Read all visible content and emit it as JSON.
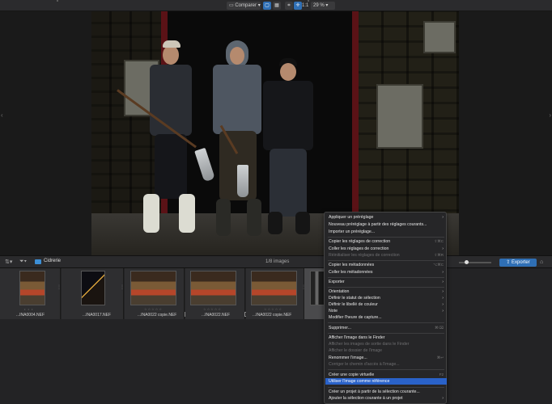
{
  "toolbar": {
    "compare_label": "Comparer",
    "ratio_label": "1:1",
    "zoom_value": "29 %"
  },
  "strip_bar": {
    "folder_name": "Cidrerie",
    "count": "1/8 images",
    "export_label": "Exporter"
  },
  "thumbnails": [
    {
      "filename": "...INA0004.NEF"
    },
    {
      "filename": "...INA0017.NEF"
    },
    {
      "filename": "...INA0022 copie.NEF"
    },
    {
      "filename": "...INA0022.NEF"
    },
    {
      "filename": "...INA0022 copie.NEF"
    }
  ],
  "menu": {
    "items": [
      {
        "label": "Appliquer un préréglage",
        "arrow": "›"
      },
      {
        "label": "Nouveau préréglage à partir des réglages courants..."
      },
      {
        "label": "Importer un préréglage..."
      },
      {
        "label": "Copier les réglages de correction",
        "shortcut": "⇧⌘C"
      },
      {
        "label": "Coller les réglages de correction",
        "arrow": "›"
      },
      {
        "label": "Réinitialiser les réglages de correction",
        "shortcut": "⇧⌘R"
      },
      {
        "label": "Copier les métadonnées",
        "shortcut": "⌥⌘C"
      },
      {
        "label": "Coller les métadonnées",
        "arrow": "›"
      },
      {
        "label": "Exporter",
        "arrow": "›"
      },
      {
        "label": "Orientation",
        "arrow": "›"
      },
      {
        "label": "Définir le statut de sélection",
        "arrow": "›"
      },
      {
        "label": "Définir le libellé de couleur",
        "arrow": "›"
      },
      {
        "label": "Note",
        "arrow": "›"
      },
      {
        "label": "Modifier l'heure de capture..."
      },
      {
        "label": "Supprimer...",
        "shortcut": "⌘⌫"
      },
      {
        "label": "Afficher l'image dans le Finder"
      },
      {
        "label": "Afficher les images de sortie dans le Finder"
      },
      {
        "label": "Afficher le dossier de l'image"
      },
      {
        "label": "Renommer l'image...",
        "shortcut": "⌘↩"
      },
      {
        "label": "Corriger le chemin d'accès à l'image..."
      },
      {
        "label": "Créer une copie virtuelle",
        "shortcut": "F2"
      },
      {
        "label": "Utiliser l'image comme référence"
      },
      {
        "label": "Créer un projet à partir de la sélection courante..."
      },
      {
        "label": "Ajouter la sélection courante à un projet",
        "arrow": "›"
      }
    ]
  },
  "colors": {
    "accent": "#2f6fb5",
    "menu_highlight": "#2a62c9",
    "folder": "#3c8fd6"
  }
}
